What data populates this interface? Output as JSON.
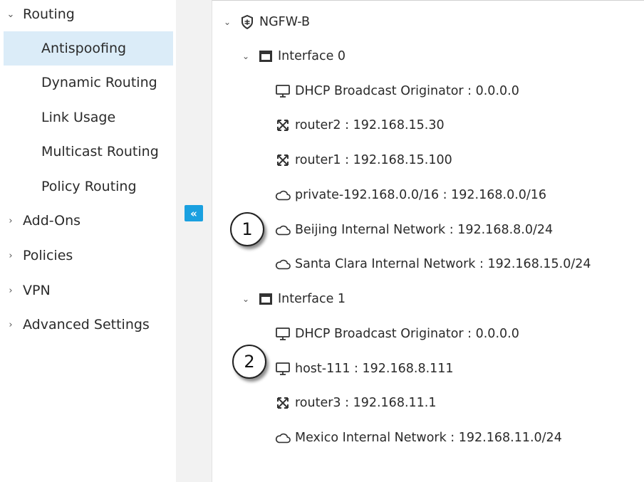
{
  "sidebar": {
    "items": [
      {
        "label": "Routing",
        "expanded": true
      },
      {
        "label": "Antispoofing",
        "selected": true
      },
      {
        "label": "Dynamic Routing"
      },
      {
        "label": "Link Usage"
      },
      {
        "label": "Multicast Routing"
      },
      {
        "label": "Policy Routing"
      },
      {
        "label": "Add-Ons",
        "expanded": false
      },
      {
        "label": "Policies",
        "expanded": false
      },
      {
        "label": "VPN",
        "expanded": false
      },
      {
        "label": "Advanced Settings",
        "expanded": false
      }
    ],
    "collapse_glyph": "«"
  },
  "tree": {
    "root": {
      "label": "NGFW-B",
      "icon": "firewall-shield-icon"
    },
    "interfaces": [
      {
        "label": "Interface 0",
        "icon": "interface-icon",
        "children": [
          {
            "label": "DHCP Broadcast Originator : 0.0.0.0",
            "icon": "host-icon"
          },
          {
            "label": "router2 : 192.168.15.30",
            "icon": "router-icon"
          },
          {
            "label": "router1 : 192.168.15.100",
            "icon": "router-icon"
          },
          {
            "label": "private-192.168.0.0/16 : 192.168.0.0/16",
            "icon": "network-cloud-icon"
          },
          {
            "label": "Beijing Internal Network : 192.168.8.0/24",
            "icon": "network-cloud-icon"
          },
          {
            "label": "Santa Clara Internal Network : 192.168.15.0/24",
            "icon": "network-cloud-icon"
          }
        ]
      },
      {
        "label": "Interface 1",
        "icon": "interface-icon",
        "children": [
          {
            "label": "DHCP Broadcast Originator : 0.0.0.0",
            "icon": "host-icon"
          },
          {
            "label": "host-111 : 192.168.8.111",
            "icon": "host-icon"
          },
          {
            "label": "router3 : 192.168.11.1",
            "icon": "router-icon"
          },
          {
            "label": "Mexico Internal Network : 192.168.11.0/24",
            "icon": "network-cloud-icon"
          }
        ]
      }
    ]
  },
  "callouts": [
    "1",
    "2"
  ],
  "colors": {
    "selected_bg": "#dbecf8",
    "accent": "#1aa0e0"
  }
}
